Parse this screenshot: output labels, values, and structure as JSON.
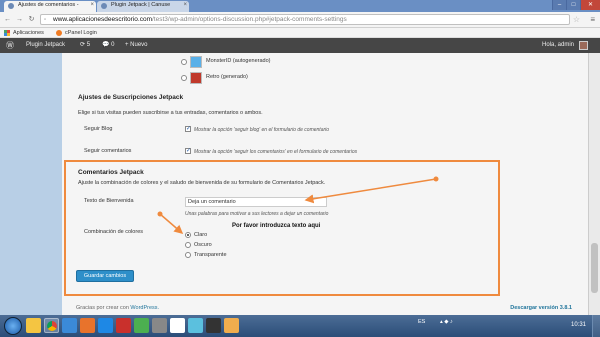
{
  "browser": {
    "tabs": [
      {
        "label": "Ajustes de comentarios - ",
        "active": true
      },
      {
        "label": "Plugin Jetpack | Canuse",
        "active": false
      }
    ],
    "url_host": "www.aplicacionesdeescritorio.com",
    "url_path": "/test3/wp-admin/options-discussion.php#jetpack-comments-settings",
    "bookmarks": [
      "Aplicaciones",
      "cPanel Login"
    ]
  },
  "adminbar": {
    "wp_logo": "Ⓦ",
    "site_name": "Plugin Jetpack",
    "updates_count": "5",
    "comments_count": "0",
    "new_label": "+ Nuevo",
    "greeting": "Hola, admin"
  },
  "avatars": [
    {
      "label": "MonsterID (autogenerado)",
      "checked": false,
      "color": "#3a9ad9"
    },
    {
      "label": "Retro (generado)",
      "checked": false,
      "color": "#c0392b"
    }
  ],
  "subscriptions": {
    "heading": "Ajustes de Suscripciones Jetpack",
    "intro": "Elige si tus visitas pueden suscribirse a tus entradas, comentarios o ambos.",
    "rows": [
      {
        "label": "Seguir Blog",
        "checkbox_text": "Mostrar la opción 'seguir blog' en el formulario de comentario",
        "checked": true
      },
      {
        "label": "Seguir comentarios",
        "checkbox_text": "Mostrar la opción 'seguir los comentarios' en el formulario de comentarios",
        "checked": true
      }
    ]
  },
  "comments": {
    "heading": "Comentarios Jetpack",
    "intro": "Ajuste la combinación de colores y el saludo de bienvenida de su formulario de Comentarios Jetpack.",
    "greeting_label": "Texto de Bienvenida",
    "greeting_value": "Deja un comentario",
    "greeting_desc": "Unas palabras para motivar a sus lectores a dejar un comentario",
    "color_label": "Combinación de colores",
    "color_options": [
      {
        "label": "Claro",
        "checked": true
      },
      {
        "label": "Oscuro",
        "checked": false
      },
      {
        "label": "Transparente",
        "checked": false
      }
    ],
    "annotation": "Por favor introduzca texto aqui",
    "save_label": "Guardar cambios"
  },
  "footer": {
    "thanks_prefix": "Gracias por crear con ",
    "thanks_link": "WordPress.",
    "version": "Descargar versión 3.8.1"
  },
  "taskbar": {
    "language": "ES",
    "clock": "10:31"
  },
  "colors": {
    "highlight": "#ef8a3e",
    "primary_button": "#2e8fc9",
    "adminbar": "#464646",
    "taskbar": "#2b4d78"
  }
}
